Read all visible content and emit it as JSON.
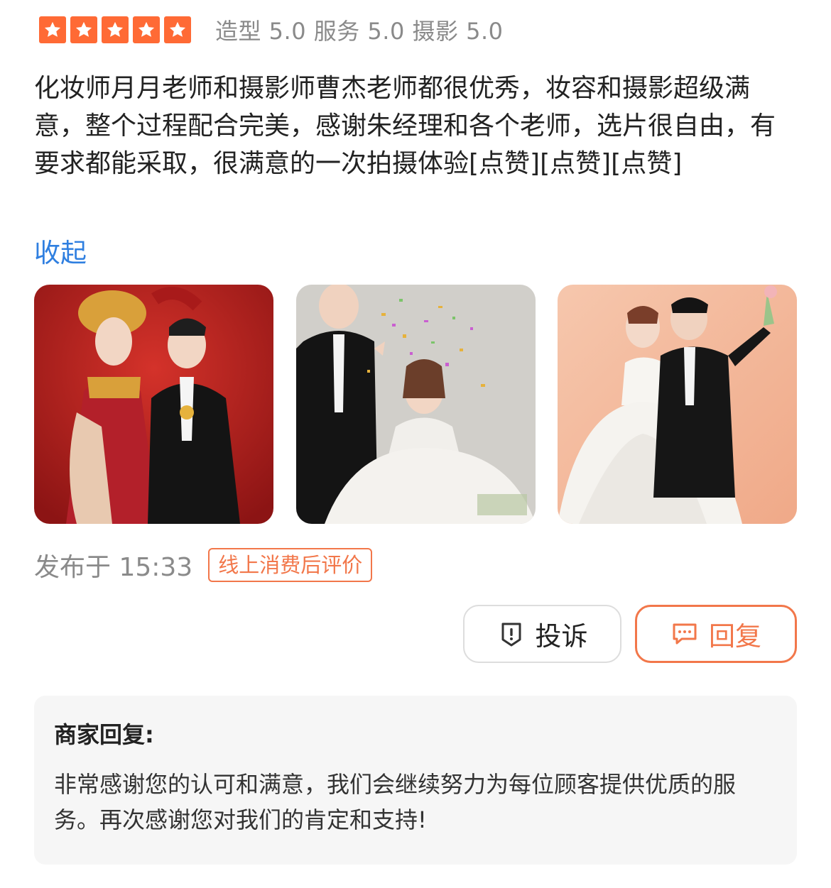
{
  "rating": {
    "stars": 5,
    "star_color": "#ff6a35",
    "scores": "造型 5.0 服务 5.0 摄影 5.0"
  },
  "review": {
    "text": "化妆师月月老师和摄影师曹杰老师都很优秀，妆容和摄影超级满意，整个过程配合完美，感谢朱经理和各个老师，选片很自由，有要求都能采取，很满意的一次拍摄体验[点赞][点赞][点赞]",
    "collapse_label": "收起"
  },
  "photos": [
    {
      "icon": "wedding-photo-red-chinese-attire"
    },
    {
      "icon": "wedding-photo-confetti-gray"
    },
    {
      "icon": "wedding-photo-peach-backdrop"
    }
  ],
  "post": {
    "time": "发布于 15:33",
    "badge": "线上消费后评价"
  },
  "actions": {
    "complain_label": "投诉",
    "complain_icon": "shield-alert-icon",
    "reply_label": "回复",
    "reply_icon": "chat-bubble-icon",
    "accent_color": "#f2774a"
  },
  "merchant_reply": {
    "title": "商家回复:",
    "text": "非常感谢您的认可和满意，我们会继续努力为每位顾客提供优质的服务。再次感谢您对我们的肯定和支持!"
  }
}
